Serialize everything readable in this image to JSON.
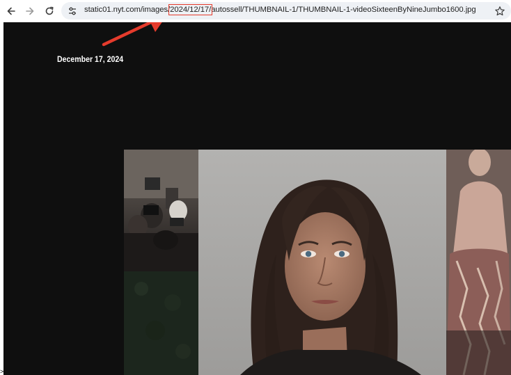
{
  "browser": {
    "url_prefix": "static01.nyt.com/images/",
    "url_highlight": "2024/12/17/",
    "url_suffix": "autossell/THUMBNAIL-1/THUMBNAIL-1-videoSixteenByNineJumbo1600.jpg",
    "icons": {
      "back": "back-arrow-icon",
      "forward": "forward-arrow-icon",
      "reload": "reload-icon",
      "site_info": "tune-icon",
      "bookmark": "star-icon"
    }
  },
  "annotation": {
    "date_text": "December 17, 2024",
    "arrow_color": "#e53b2c",
    "highlight_color": "#e53b2c"
  },
  "page": {
    "background": "#0f0f0f",
    "corner_glyph": ">"
  }
}
